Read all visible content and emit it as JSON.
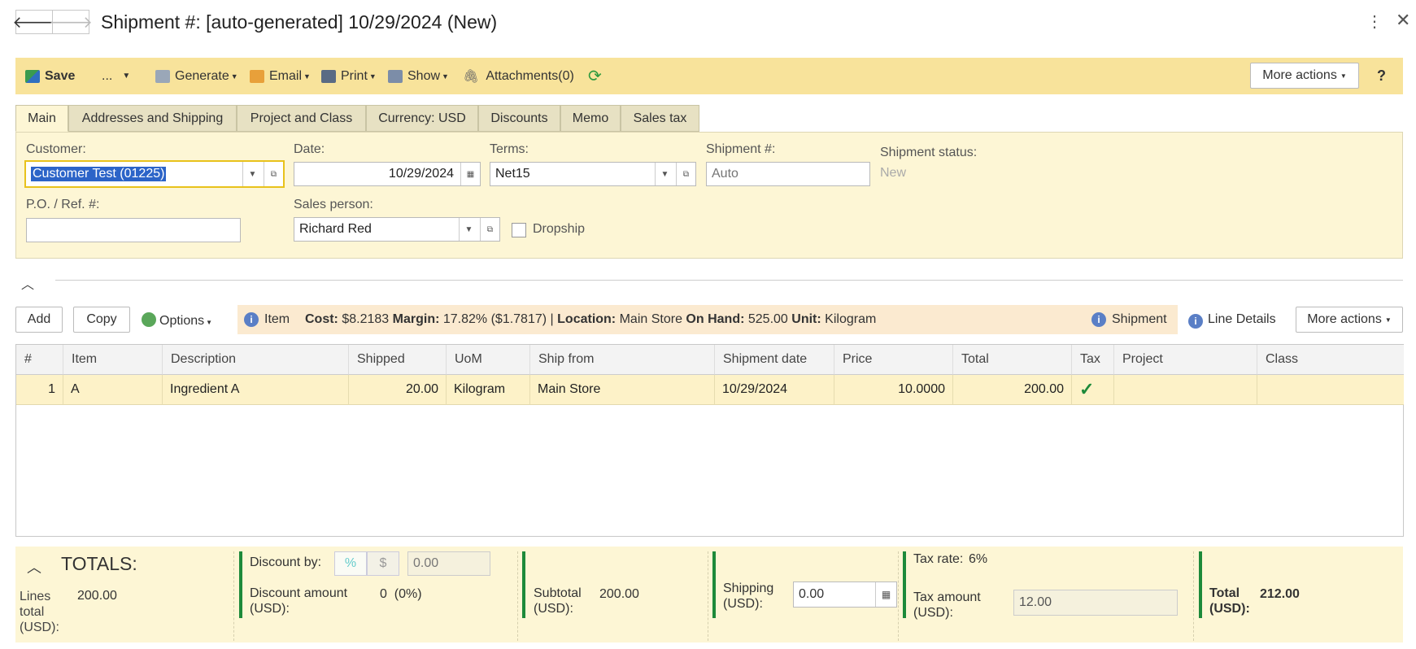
{
  "window": {
    "title": "Shipment #: [auto-generated] 10/29/2024 (New)"
  },
  "toolbar": {
    "save": "Save",
    "ellipsis": "...",
    "generate": "Generate",
    "email": "Email",
    "print": "Print",
    "show": "Show",
    "attachments": "Attachments(0)",
    "more_actions": "More actions",
    "help": "?"
  },
  "tabs": [
    "Main",
    "Addresses and Shipping",
    "Project and Class",
    "Currency: USD",
    "Discounts",
    "Memo",
    "Sales tax"
  ],
  "form": {
    "customer_label": "Customer:",
    "customer_value": "Customer Test (01225)",
    "date_label": "Date:",
    "date_value": "10/29/2024",
    "terms_label": "Terms:",
    "terms_value": "Net15",
    "shipment_no_label": "Shipment #:",
    "shipment_no_placeholder": "Auto",
    "status_label": "Shipment status:",
    "status_value": "New",
    "po_label": "P.O. / Ref. #:",
    "po_value": "",
    "salesperson_label": "Sales person:",
    "salesperson_value": "Richard Red",
    "dropship_label": "Dropship"
  },
  "grid_toolbar": {
    "add": "Add",
    "copy": "Copy",
    "options": "Options",
    "item_label": "Item",
    "cost_label": "Cost:",
    "cost_value": "$8.2183",
    "margin_label": "Margin:",
    "margin_value": "17.82% ($1.7817) |",
    "location_label": "Location:",
    "location_value": "Main Store",
    "onhand_label": "On Hand:",
    "onhand_value": "525.00",
    "unit_label": "Unit:",
    "unit_value": "Kilogram",
    "shipment": "Shipment",
    "line_details": "Line Details",
    "more_actions": "More actions"
  },
  "grid": {
    "columns": [
      "#",
      "Item",
      "Description",
      "Shipped",
      "UoM",
      "Ship from",
      "Shipment date",
      "Price",
      "Total",
      "Tax",
      "Project",
      "Class"
    ],
    "rows": [
      {
        "num": "1",
        "item": "A",
        "description": "Ingredient A",
        "shipped": "20.00",
        "uom": "Kilogram",
        "ship_from": "Main Store",
        "shipment_date": "10/29/2024",
        "price": "10.0000",
        "total": "200.00",
        "tax": "✓",
        "project": "",
        "class": ""
      }
    ]
  },
  "totals": {
    "heading": "TOTALS:",
    "lines_total_label_1": "Lines",
    "lines_total_label_2": "total",
    "lines_total_label_3": "(USD):",
    "lines_total_value": "200.00",
    "discount_by_label": "Discount by:",
    "discount_pct": "%",
    "discount_dollar": "$",
    "discount_by_value": "0.00",
    "discount_amount_label_1": "Discount amount",
    "discount_amount_label_2": "(USD):",
    "discount_amount_value": "0",
    "discount_amount_pct": "(0%)",
    "subtotal_label_1": "Subtotal",
    "subtotal_label_2": "(USD):",
    "subtotal_value": "200.00",
    "shipping_label_1": "Shipping",
    "shipping_label_2": "(USD):",
    "shipping_value": "0.00",
    "tax_rate_label": "Tax rate:",
    "tax_rate_value": "6%",
    "tax_amount_label_1": "Tax amount",
    "tax_amount_label_2": "(USD):",
    "tax_amount_value": "12.00",
    "total_label_1": "Total",
    "total_label_2": "(USD):",
    "total_value": "212.00"
  },
  "colors": {
    "toolbar_bg": "#f8e39b",
    "panel_bg": "#fdf6d5",
    "accent_green": "#1d8a3a",
    "focus_yellow": "#e8c21c",
    "selection_blue": "#2c64c8"
  }
}
